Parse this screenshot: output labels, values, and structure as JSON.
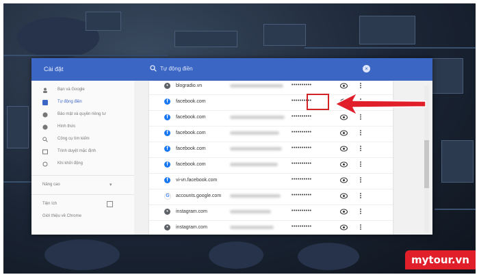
{
  "app": {
    "title": "Cài đặt"
  },
  "search": {
    "value": "Tự động điền",
    "clear_icon": "close-icon"
  },
  "sidebar": {
    "items": [
      {
        "label": "Bạn và Google",
        "icon": "person-icon",
        "active": false
      },
      {
        "label": "Tự động điền",
        "icon": "autofill-icon",
        "active": true
      },
      {
        "label": "Bảo mật và quyền riêng tư",
        "icon": "shield-icon",
        "active": false
      },
      {
        "label": "Hình thức",
        "icon": "palette-icon",
        "active": false
      },
      {
        "label": "Công cụ tìm kiếm",
        "icon": "search-icon",
        "active": false
      },
      {
        "label": "Trình duyệt mặc định",
        "icon": "browser-icon",
        "active": false
      },
      {
        "label": "Khi khởi động",
        "icon": "power-icon",
        "active": false
      }
    ],
    "advanced": "Nâng cao",
    "extensions": "Tiện ích",
    "about": "Giới thiệu về Chrome"
  },
  "passwords": {
    "rows": [
      {
        "site": "blogradio.vn",
        "icon": "globe-icon",
        "password": "••••••••••"
      },
      {
        "site": "facebook.com",
        "icon": "facebook-icon",
        "password": "••••••••••"
      },
      {
        "site": "facebook.com",
        "icon": "facebook-icon",
        "password": "••••••••••"
      },
      {
        "site": "facebook.com",
        "icon": "facebook-icon",
        "password": "••••••••••"
      },
      {
        "site": "facebook.com",
        "icon": "facebook-icon",
        "password": "••••••••••"
      },
      {
        "site": "facebook.com",
        "icon": "facebook-icon",
        "password": "••••••••••"
      },
      {
        "site": "vi-vn.facebook.com",
        "icon": "facebook-icon",
        "password": "••••••••••"
      },
      {
        "site": "accounts.google.com",
        "icon": "google-icon",
        "password": "••••••••••"
      },
      {
        "site": "instagram.com",
        "icon": "globe-icon",
        "password": "••••••••••"
      },
      {
        "site": "instagram.com",
        "icon": "globe-icon",
        "password": "••••••••••"
      }
    ]
  },
  "watermark": {
    "text": "mytour.vn"
  },
  "colors": {
    "accent": "#3b66c4",
    "highlight": "#d32226",
    "facebook": "#1877f2",
    "badge": "#e01f2b"
  }
}
